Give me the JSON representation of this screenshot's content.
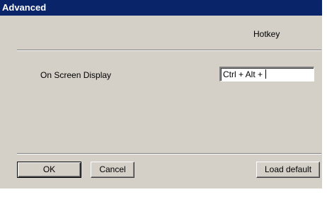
{
  "window": {
    "title": "Advanced"
  },
  "columns": {
    "hotkey_header": "Hotkey"
  },
  "settings": [
    {
      "label": "On Screen Display",
      "hotkey_value": "Ctrl + Alt + "
    }
  ],
  "buttons": {
    "ok_label": "OK",
    "cancel_label": "Cancel",
    "load_default_label": "Load default"
  },
  "colors": {
    "titlebar": "#0a246a",
    "dialog_face": "#d4d0c8"
  }
}
